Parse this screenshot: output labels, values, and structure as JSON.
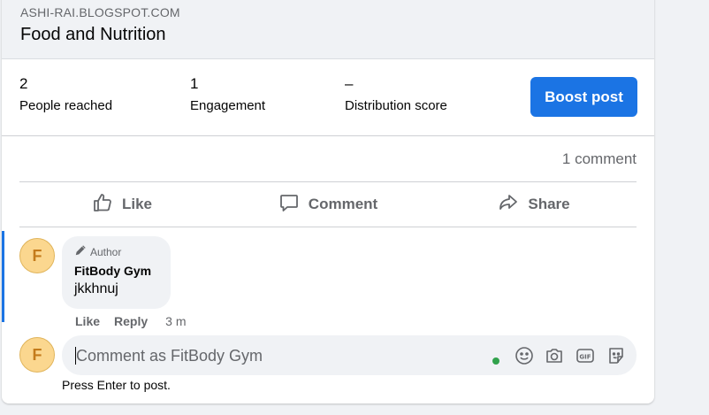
{
  "link_preview": {
    "domain": "ASHI-RAI.BLOGSPOT.COM",
    "title": "Food and Nutrition"
  },
  "stats": [
    {
      "value": "2",
      "label": "People reached"
    },
    {
      "value": "1",
      "label": "Engagement"
    },
    {
      "value": "–",
      "label": "Distribution score"
    }
  ],
  "boost_label": "Boost post",
  "comment_count": "1 comment",
  "actions": {
    "like": "Like",
    "comment": "Comment",
    "share": "Share"
  },
  "comment": {
    "avatar_letter": "F",
    "badge": "Author",
    "author": "FitBody Gym",
    "text": "jkkhnuj",
    "like": "Like",
    "reply": "Reply",
    "time": "3 m"
  },
  "composer": {
    "avatar_letter": "F",
    "placeholder": "Comment as FitBody Gym",
    "hint": "Press Enter to post.",
    "icons": [
      "emoji-icon",
      "camera-icon",
      "gif-icon",
      "sticker-icon"
    ]
  },
  "colors": {
    "accent": "#1b74e4",
    "online": "#31a24c",
    "avatar": "#fbd78f"
  }
}
